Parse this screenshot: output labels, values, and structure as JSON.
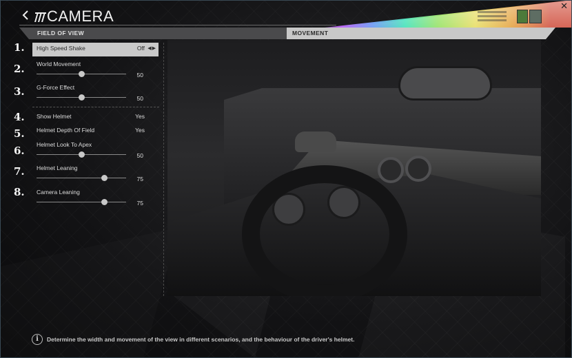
{
  "header": {
    "title": "CAMERA",
    "close_glyph": "✕",
    "back_icon": "chevron-left-icon",
    "logo_icon": "stripes-logo-icon"
  },
  "tabs": [
    {
      "label": "FIELD OF VIEW",
      "active": false
    },
    {
      "label": "MOVEMENT",
      "active": true
    }
  ],
  "settings": [
    {
      "num": "1.",
      "label": "High Speed Shake",
      "value": "Off",
      "type": "selector",
      "highlighted": true
    },
    {
      "num": "2.",
      "label": "World Movement",
      "value": "50",
      "type": "slider",
      "fraction": 0.5
    },
    {
      "num": "3.",
      "label": "G-Force Effect",
      "value": "50",
      "type": "slider",
      "fraction": 0.5
    },
    {
      "num": "4.",
      "label": "Show Helmet",
      "value": "Yes",
      "type": "toggle"
    },
    {
      "num": "5.",
      "label": "Helmet Depth Of Field",
      "value": "Yes",
      "type": "toggle"
    },
    {
      "num": "6.",
      "label": "Helmet Look To Apex",
      "value": "50",
      "type": "slider",
      "fraction": 0.5
    },
    {
      "num": "7.",
      "label": "Helmet Leaning",
      "value": "75",
      "type": "slider",
      "fraction": 0.75
    },
    {
      "num": "8.",
      "label": "Camera Leaning",
      "value": "75",
      "type": "slider",
      "fraction": 0.75
    }
  ],
  "selector_arrows": "◀▶",
  "footer": {
    "info_glyph": "i",
    "text": "Determine the width and movement of the view in different scenarios, and the behaviour of the driver's helmet."
  },
  "colors": {
    "tab_active_bg": "#c8c8c8",
    "tab_inactive_bg": "#4a4a4c",
    "highlight_row": "#c9c9c9"
  }
}
